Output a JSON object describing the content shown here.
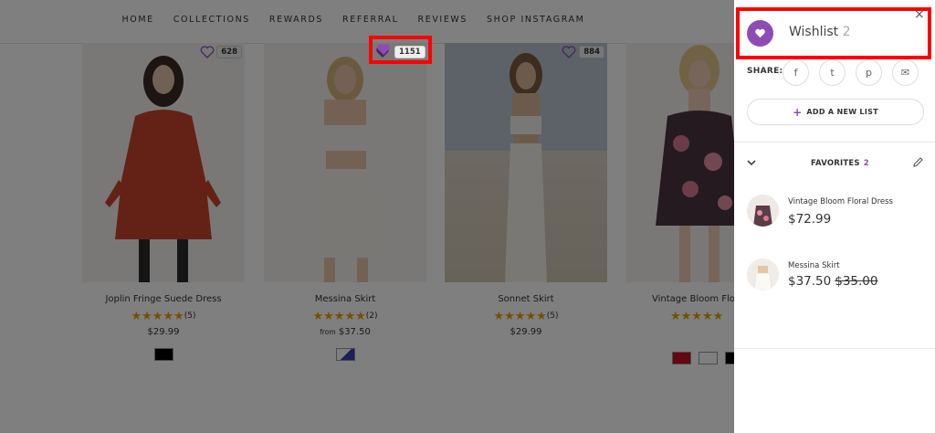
{
  "nav": {
    "items": [
      "HOME",
      "COLLECTIONS",
      "REWARDS",
      "REFERRAL",
      "REVIEWS",
      "SHOP INSTAGRAM"
    ]
  },
  "products": [
    {
      "title": "Joplin Fringe Suede Dress",
      "likes": "628",
      "rating_count": "(5)",
      "price_prefix": "",
      "price": "$29.99",
      "swatches": [
        "#000000"
      ]
    },
    {
      "title": "Messina Skirt",
      "likes": "1151",
      "rating_count": "(2)",
      "price_prefix": "from",
      "price": "$37.50",
      "swatches": [
        "#3a3fb0"
      ]
    },
    {
      "title": "Sonnet Skirt",
      "likes": "884",
      "rating_count": "(5)",
      "price_prefix": "",
      "price": "$29.99",
      "swatches": []
    },
    {
      "title": "Vintage Bloom Flora",
      "likes": "",
      "rating_count": "",
      "price_prefix": "",
      "price": "",
      "swatches": [
        "#c1121f",
        "#ffffff",
        "#000000"
      ]
    }
  ],
  "stars": "★★★★★",
  "wishlist": {
    "title": "Wishlist",
    "count": "2",
    "close": "×",
    "share_label": "SHARE:",
    "share_icons": [
      "f",
      "t",
      "p",
      "✉"
    ],
    "add_list_label": "ADD A NEW LIST",
    "plus": "+",
    "list_name": "FAVORITES",
    "list_count": "2",
    "items": [
      {
        "name": "Vintage Bloom Floral Dress",
        "price": "$72.99",
        "old_price": ""
      },
      {
        "name": "Messina Skirt",
        "price": "$37.50",
        "old_price": "$35.00"
      }
    ]
  },
  "colors": {
    "accent": "#8e4bb8",
    "highlight": "#ff0000",
    "star": "#e6a100"
  }
}
